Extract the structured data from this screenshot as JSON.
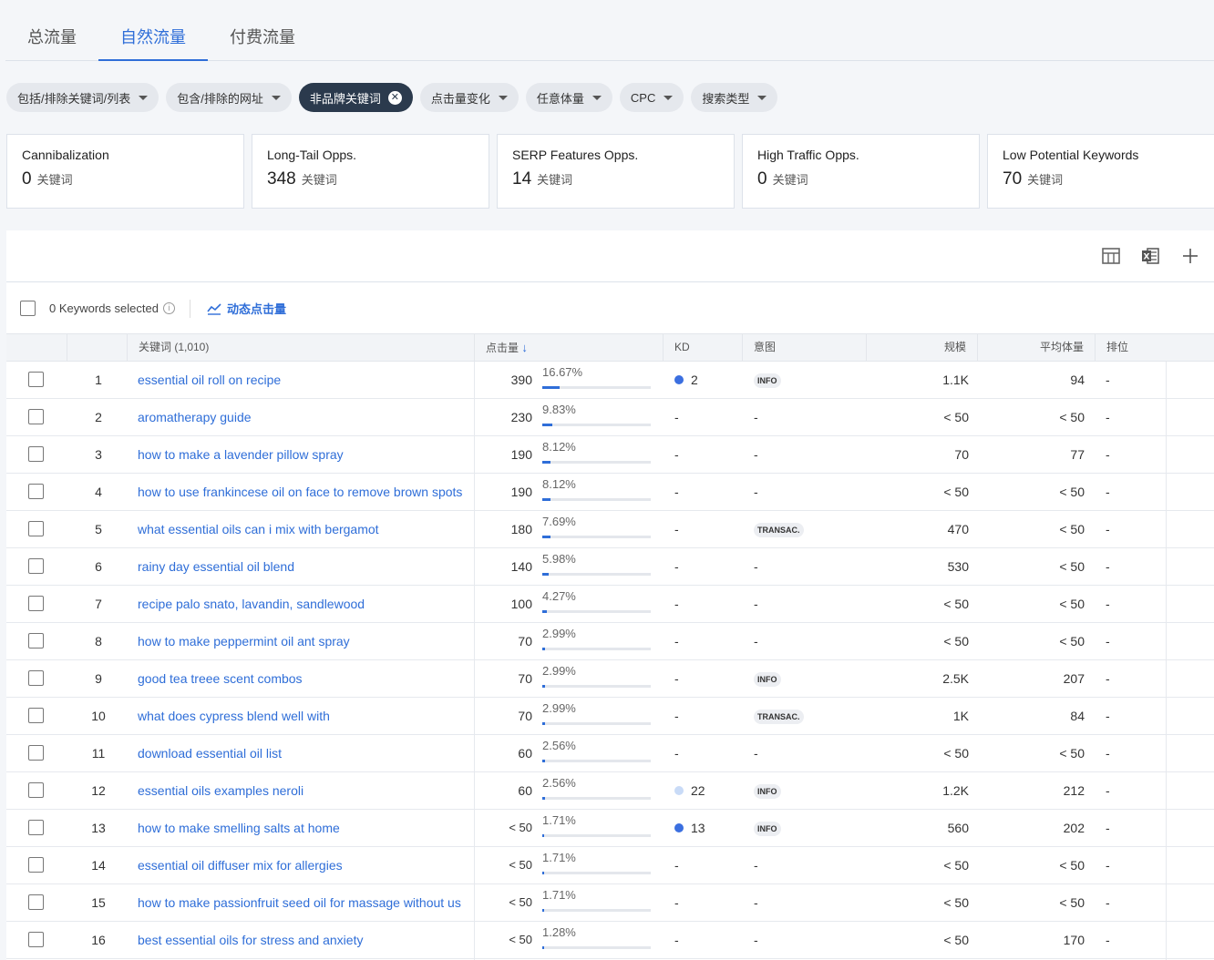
{
  "tabs": [
    {
      "label": "总流量",
      "active": false
    },
    {
      "label": "自然流量",
      "active": true
    },
    {
      "label": "付费流量",
      "active": false
    }
  ],
  "filters": [
    {
      "label": "包括/排除关键词/列表",
      "active": false
    },
    {
      "label": "包含/排除的网址",
      "active": false
    },
    {
      "label": "非品牌关键词",
      "active": true
    },
    {
      "label": "点击量变化",
      "active": false
    },
    {
      "label": "任意体量",
      "active": false
    },
    {
      "label": "CPC",
      "active": false
    },
    {
      "label": "搜索类型",
      "active": false
    }
  ],
  "cards": [
    {
      "title": "Cannibalization",
      "value": "0",
      "unit": "关键词"
    },
    {
      "title": "Long-Tail Opps.",
      "value": "348",
      "unit": "关键词"
    },
    {
      "title": "SERP Features Opps.",
      "value": "14",
      "unit": "关键词"
    },
    {
      "title": "High Traffic Opps.",
      "value": "0",
      "unit": "关键词"
    },
    {
      "title": "Low Potential Keywords",
      "value": "70",
      "unit": "关键词"
    }
  ],
  "selection": {
    "label": "0 Keywords selected",
    "dynamic_label": "动态点击量"
  },
  "columns": {
    "keyword": "关键词 (1,010)",
    "clicks": "点击量",
    "kd": "KD",
    "intent": "意图",
    "scale": "规模",
    "avg_volume": "平均体量",
    "rank": "排位"
  },
  "colors": {
    "accent": "#2f6ed8",
    "kd_low": "#3b6fe0",
    "kd_light": "#c9dbf7"
  },
  "rows": [
    {
      "num": "1",
      "keyword": "essential oil roll on recipe",
      "clicks": "390",
      "pct": "16.67%",
      "pct_value": 16.67,
      "kd": "2",
      "kd_color": "#3b6fe0",
      "intent": "INFO",
      "scale": "1.1K",
      "avg": "94",
      "rank": "-"
    },
    {
      "num": "2",
      "keyword": "aromatherapy guide",
      "clicks": "230",
      "pct": "9.83%",
      "pct_value": 9.83,
      "kd": "-",
      "kd_color": "",
      "intent": "-",
      "scale": "< 50",
      "avg": "< 50",
      "rank": "-"
    },
    {
      "num": "3",
      "keyword": "how to make a lavender pillow spray",
      "clicks": "190",
      "pct": "8.12%",
      "pct_value": 8.12,
      "kd": "-",
      "kd_color": "",
      "intent": "-",
      "scale": "70",
      "avg": "77",
      "rank": "-"
    },
    {
      "num": "4",
      "keyword": "how to use frankincese oil on face to remove brown spots",
      "clicks": "190",
      "pct": "8.12%",
      "pct_value": 8.12,
      "kd": "-",
      "kd_color": "",
      "intent": "-",
      "scale": "< 50",
      "avg": "< 50",
      "rank": "-"
    },
    {
      "num": "5",
      "keyword": "what essential oils can i mix with bergamot",
      "clicks": "180",
      "pct": "7.69%",
      "pct_value": 7.69,
      "kd": "-",
      "kd_color": "",
      "intent": "TRANSAC.",
      "scale": "470",
      "avg": "< 50",
      "rank": "-"
    },
    {
      "num": "6",
      "keyword": "rainy day essential oil blend",
      "clicks": "140",
      "pct": "5.98%",
      "pct_value": 5.98,
      "kd": "-",
      "kd_color": "",
      "intent": "-",
      "scale": "530",
      "avg": "< 50",
      "rank": "-"
    },
    {
      "num": "7",
      "keyword": "recipe palo snato, lavandin, sandlewood",
      "clicks": "100",
      "pct": "4.27%",
      "pct_value": 4.27,
      "kd": "-",
      "kd_color": "",
      "intent": "-",
      "scale": "< 50",
      "avg": "< 50",
      "rank": "-"
    },
    {
      "num": "8",
      "keyword": "how to make peppermint oil ant spray",
      "clicks": "70",
      "pct": "2.99%",
      "pct_value": 2.99,
      "kd": "-",
      "kd_color": "",
      "intent": "-",
      "scale": "< 50",
      "avg": "< 50",
      "rank": "-"
    },
    {
      "num": "9",
      "keyword": "good tea treee scent combos",
      "clicks": "70",
      "pct": "2.99%",
      "pct_value": 2.99,
      "kd": "-",
      "kd_color": "",
      "intent": "INFO",
      "scale": "2.5K",
      "avg": "207",
      "rank": "-"
    },
    {
      "num": "10",
      "keyword": "what does cypress blend well with",
      "clicks": "70",
      "pct": "2.99%",
      "pct_value": 2.99,
      "kd": "-",
      "kd_color": "",
      "intent": "TRANSAC.",
      "scale": "1K",
      "avg": "84",
      "rank": "-"
    },
    {
      "num": "11",
      "keyword": "download essential oil list",
      "clicks": "60",
      "pct": "2.56%",
      "pct_value": 2.56,
      "kd": "-",
      "kd_color": "",
      "intent": "-",
      "scale": "< 50",
      "avg": "< 50",
      "rank": "-"
    },
    {
      "num": "12",
      "keyword": "essential oils examples neroli",
      "clicks": "60",
      "pct": "2.56%",
      "pct_value": 2.56,
      "kd": "22",
      "kd_color": "#c9dbf7",
      "intent": "INFO",
      "scale": "1.2K",
      "avg": "212",
      "rank": "-"
    },
    {
      "num": "13",
      "keyword": "how to make smelling salts at home",
      "clicks": "< 50",
      "pct": "1.71%",
      "pct_value": 1.71,
      "kd": "13",
      "kd_color": "#3b6fe0",
      "intent": "INFO",
      "scale": "560",
      "avg": "202",
      "rank": "-"
    },
    {
      "num": "14",
      "keyword": "essential oil diffuser mix for allergies",
      "clicks": "< 50",
      "pct": "1.71%",
      "pct_value": 1.71,
      "kd": "-",
      "kd_color": "",
      "intent": "-",
      "scale": "< 50",
      "avg": "< 50",
      "rank": "-"
    },
    {
      "num": "15",
      "keyword": "how to make passionfruit seed oil for massage without us",
      "clicks": "< 50",
      "pct": "1.71%",
      "pct_value": 1.71,
      "kd": "-",
      "kd_color": "",
      "intent": "-",
      "scale": "< 50",
      "avg": "< 50",
      "rank": "-"
    },
    {
      "num": "16",
      "keyword": "best essential oils for stress and anxiety",
      "clicks": "< 50",
      "pct": "1.28%",
      "pct_value": 1.28,
      "kd": "-",
      "kd_color": "",
      "intent": "-",
      "scale": "< 50",
      "avg": "170",
      "rank": "-"
    }
  ]
}
